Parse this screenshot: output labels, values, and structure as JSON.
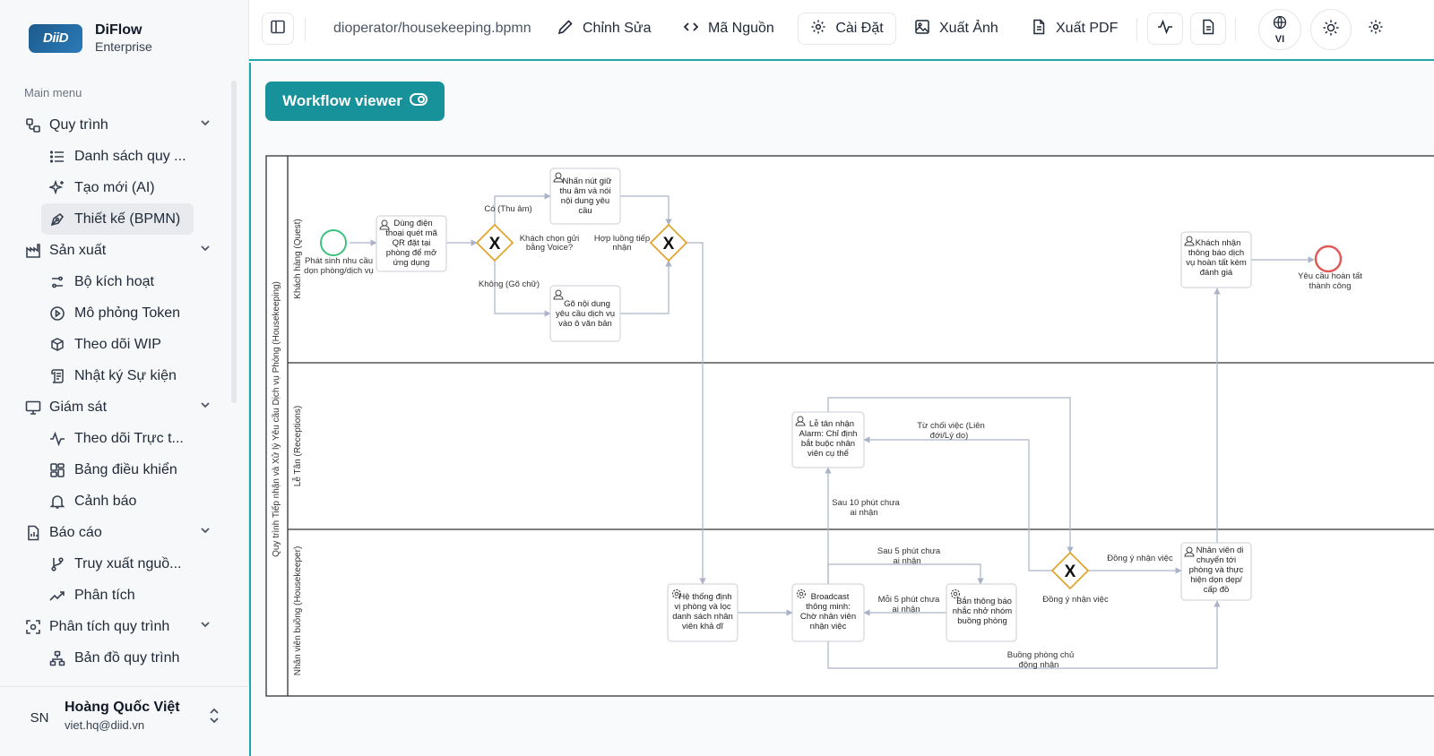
{
  "brand": {
    "logo": "DiiD",
    "title": "DiFlow",
    "subtitle": "Enterprise"
  },
  "sidebar": {
    "section": "Main menu",
    "groups": [
      {
        "label": "Quy trình",
        "items": [
          "Danh sách quy ...",
          "Tạo mới (AI)",
          "Thiết kế (BPMN)"
        ]
      },
      {
        "label": "Sản xuất",
        "items": [
          "Bộ kích hoạt",
          "Mô phỏng Token",
          "Theo dõi WIP",
          "Nhật ký Sự kiện"
        ]
      },
      {
        "label": "Giám sát",
        "items": [
          "Theo dõi Trực t...",
          "Bảng điều khiển",
          "Cảnh báo"
        ]
      },
      {
        "label": "Báo cáo",
        "items": [
          "Truy xuất nguồ...",
          "Phân tích"
        ]
      },
      {
        "label": "Phân tích quy trình",
        "items": [
          "Bản đồ quy trình"
        ]
      }
    ],
    "active": "Thiết kế (BPMN)"
  },
  "user": {
    "initials": "SN",
    "name": "Hoàng Quốc Việt",
    "email": "viet.hq@diid.vn"
  },
  "topbar": {
    "path": "dioperator/housekeeping.bpmn",
    "edit": "Chỉnh Sửa",
    "source": "Mã Nguồn",
    "settings": "Cài Đặt",
    "export_image": "Xuất Ảnh",
    "export_pdf": "Xuất PDF",
    "lang": "VI"
  },
  "viewer_button": "Workflow viewer",
  "diagram": {
    "pool": "Quy trình Tiếp nhận và Xử lý Yêu cầu Dịch vụ Phòng (Housekeeping)",
    "lanes": [
      "Khách hàng (Quest)",
      "Lễ Tân (Receptions)",
      "Nhân viên buồng (Housekeeper)"
    ],
    "start_label": [
      "Phát sinh nhu cầu",
      "dọn phòng/dịch vụ"
    ],
    "end_label": [
      "Yêu cầu hoàn tất",
      "thành công"
    ],
    "tasks": {
      "scan_qr": [
        "Dùng điện",
        "thoại quét mã",
        "QR đặt tại",
        "phòng để mở",
        "ứng dụng"
      ],
      "voice": [
        "Nhấn nút giữ",
        "thu âm và nói",
        "nội dung yêu",
        "cầu"
      ],
      "text": [
        "Gõ nội dung",
        "yêu cầu dịch vụ",
        "vào ô văn bản"
      ],
      "notify": [
        "Khách nhận",
        "thông báo dịch",
        "vụ hoàn tất kèm",
        "đánh giá"
      ],
      "reception": [
        "Lễ tân nhận",
        "Alarm: Chỉ định",
        "bắt buộc nhân",
        "viên cụ thể"
      ],
      "locate": [
        "Hệ thống định",
        "vị phòng và lọc",
        "danh sách nhân",
        "viên khả dĩ"
      ],
      "broadcast": [
        "Broadcast",
        "thông minh:",
        "Chờ nhân viên",
        "nhận việc"
      ],
      "remind": [
        "Bắn thông báo",
        "nhắc nhở nhóm",
        "buồng phòng"
      ],
      "move": [
        "Nhân viên di",
        "chuyển tới",
        "phòng và thực",
        "hiện dọn dẹp/",
        "cấp đồ"
      ]
    },
    "gateways": {
      "choice": [
        "Khách chọn gửi",
        "bằng Voice?"
      ],
      "merge": [
        "Hợp luồng tiếp",
        "nhận"
      ],
      "accept": [
        "Đồng ý nhận việc"
      ]
    },
    "flows": {
      "yes": [
        "Có (Thu âm)"
      ],
      "no": [
        "Không (Gõ chữ)"
      ],
      "after10": [
        "Sau 10 phút chưa",
        "ai nhận"
      ],
      "reject": [
        "Từ chối việc (Liên",
        "đới/Lý do)"
      ],
      "after5": [
        "Sau 5 phút chưa",
        "ai nhận"
      ],
      "every5": [
        "Mỗi 5 phút chưa",
        "ai nhận"
      ],
      "accepted": [
        "Đồng ý nhận việc"
      ],
      "owner": [
        "Buồng phòng chủ",
        "động nhận"
      ]
    },
    "gateway_marker": "X"
  }
}
